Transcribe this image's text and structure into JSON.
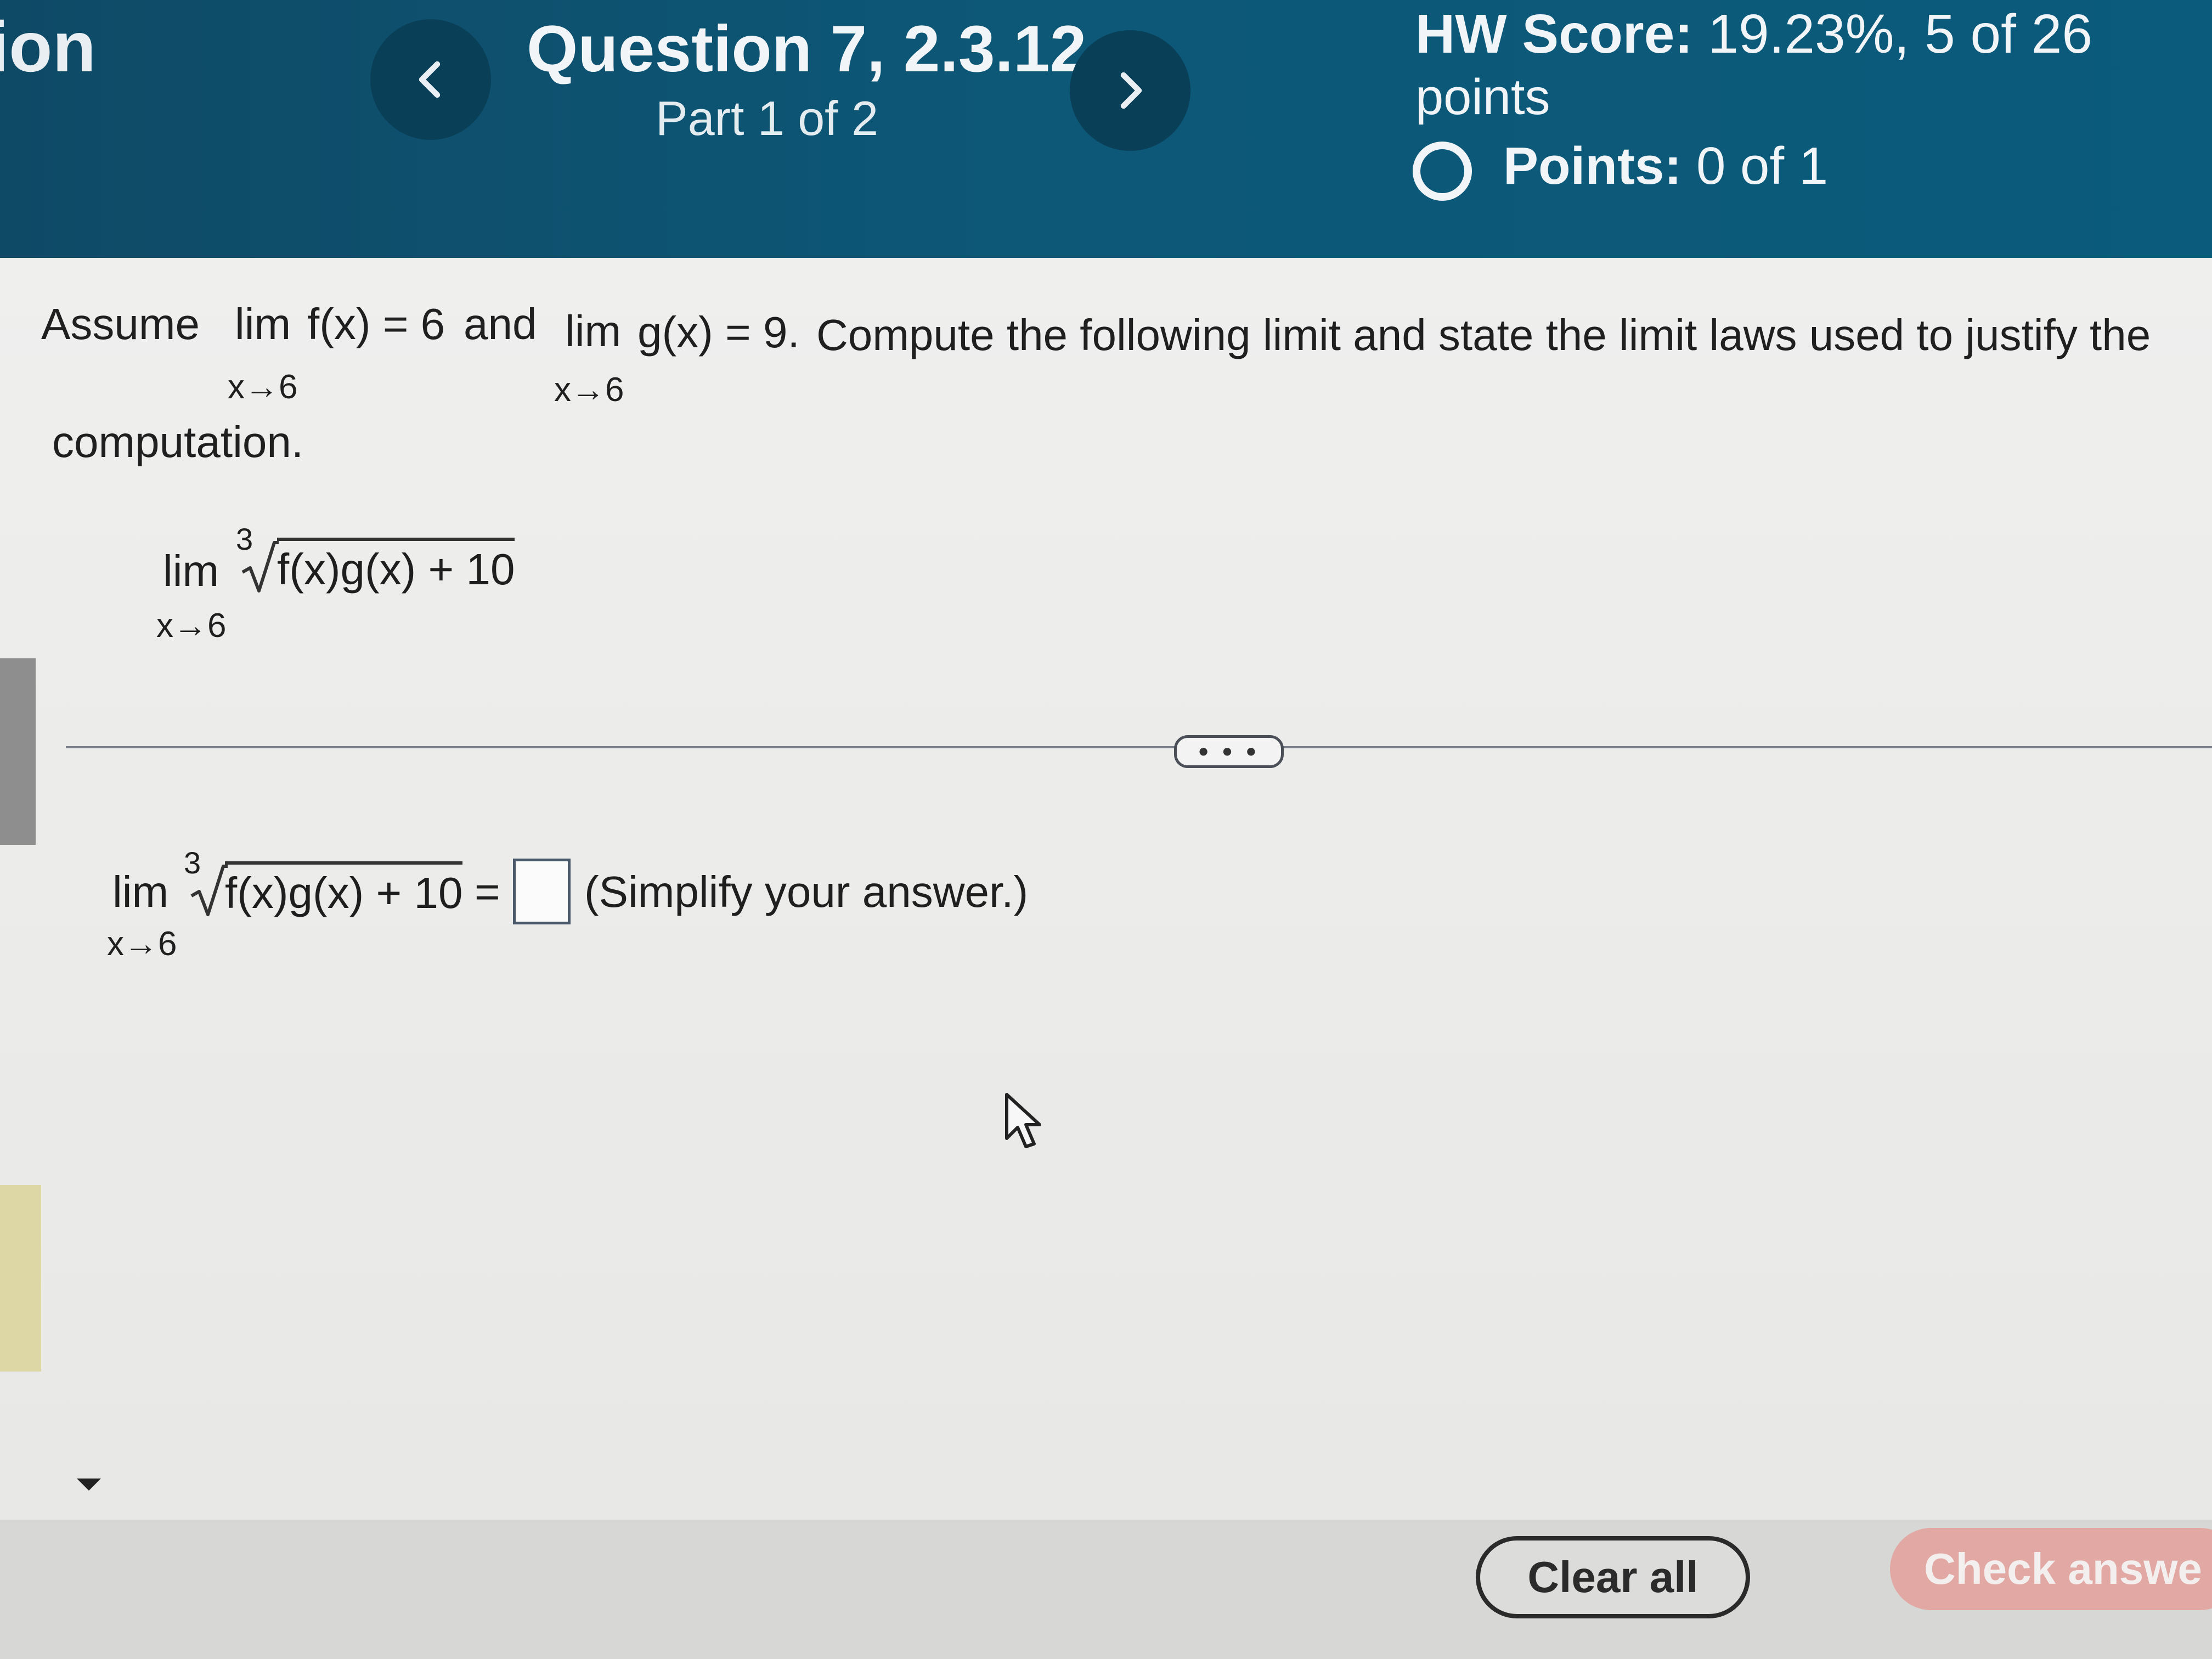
{
  "header": {
    "section_title": "ion",
    "question_title": "Question 7, 2.3.12",
    "question_part": "Part 1 of 2",
    "hw_score_label": "HW Score:",
    "hw_score_value": "19.23%, 5 of 26",
    "hw_score_unit": "points",
    "points_label": "Points:",
    "points_value": "0 of 1"
  },
  "problem": {
    "assume": "Assume",
    "lim": "lim",
    "f_expr": "f(x) = 6",
    "and": "and",
    "g_expr": "g(x) = 9.",
    "instruction": "Compute the following limit and state the limit laws used to justify the",
    "instruction_cont": "computation.",
    "approach": "x→6",
    "radical_index": "3",
    "radicand": "f(x)g(x) + 10"
  },
  "answer": {
    "lim": "lim",
    "approach": "x→6",
    "radical_index": "3",
    "radicand": "f(x)g(x) + 10",
    "equals": "=",
    "hint": "(Simplify your answer.)"
  },
  "divider": {
    "more_label": "• • •"
  },
  "footer": {
    "clear_label": "Clear all",
    "check_label": "Check answe"
  },
  "colors": {
    "header_bg": "#0d5777",
    "nav_button": "#0a3f58",
    "check_button": "#e2a8a3"
  },
  "icons": [
    "chevron-left-icon",
    "chevron-right-icon",
    "radio-circle-icon",
    "mouse-cursor-icon",
    "caret-down-icon"
  ]
}
